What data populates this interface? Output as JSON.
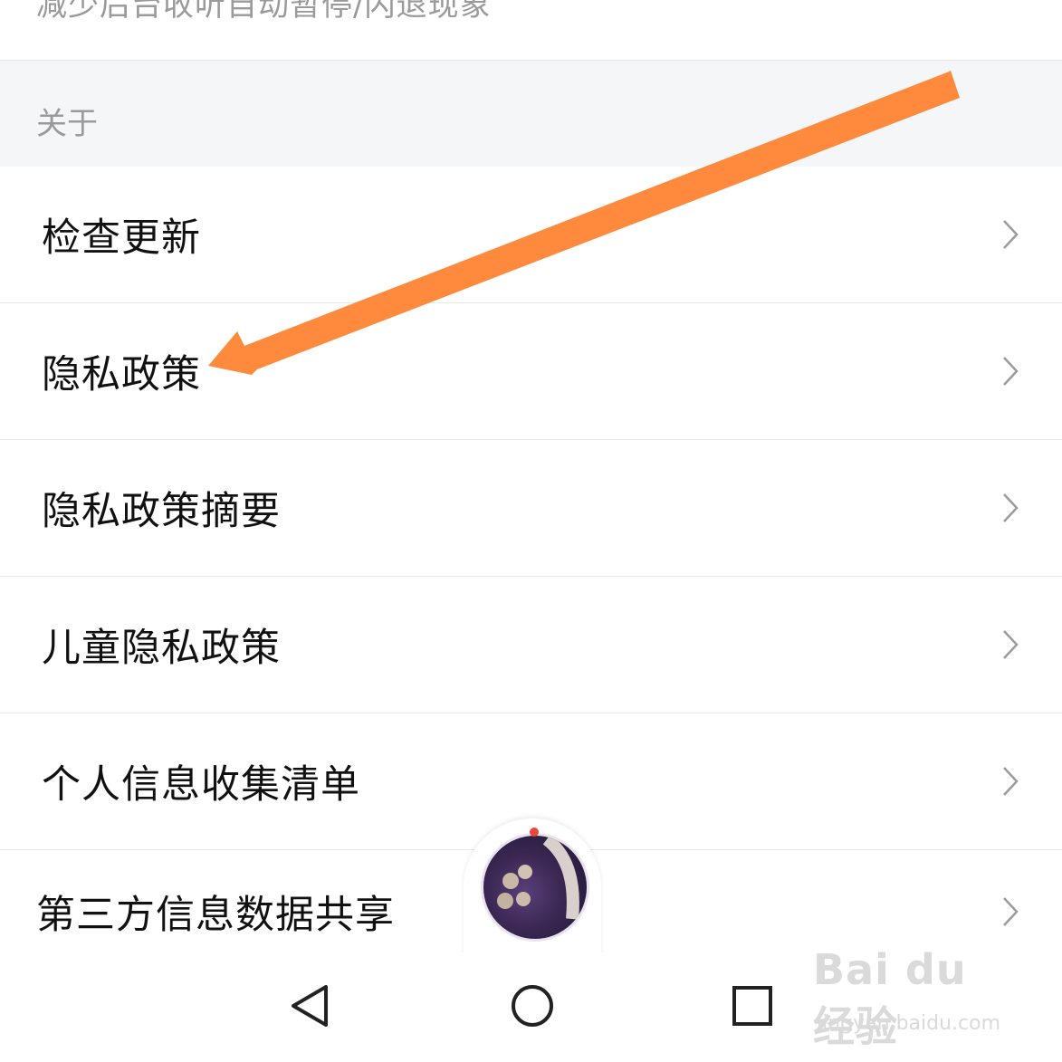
{
  "top_note": {
    "text": "减少后台收听自动暂停/闪退现象"
  },
  "section": {
    "title": "关于"
  },
  "rows": [
    {
      "label": "检查更新"
    },
    {
      "label": "隐私政策"
    },
    {
      "label": "隐私政策摘要"
    },
    {
      "label": "儿童隐私政策"
    },
    {
      "label": "个人信息收集清单"
    },
    {
      "label": "第三方信息数据共享"
    }
  ],
  "watermark": {
    "main": "Bai du 经验",
    "sub": "jingyan.baidu.com"
  },
  "colors": {
    "arrow": "#ff8a3d",
    "divider": "#e8e8e8",
    "section_bg": "#f5f6f8"
  },
  "icons": [
    "chevron-right-icon",
    "back-triangle-icon",
    "home-circle-icon",
    "recents-square-icon"
  ]
}
